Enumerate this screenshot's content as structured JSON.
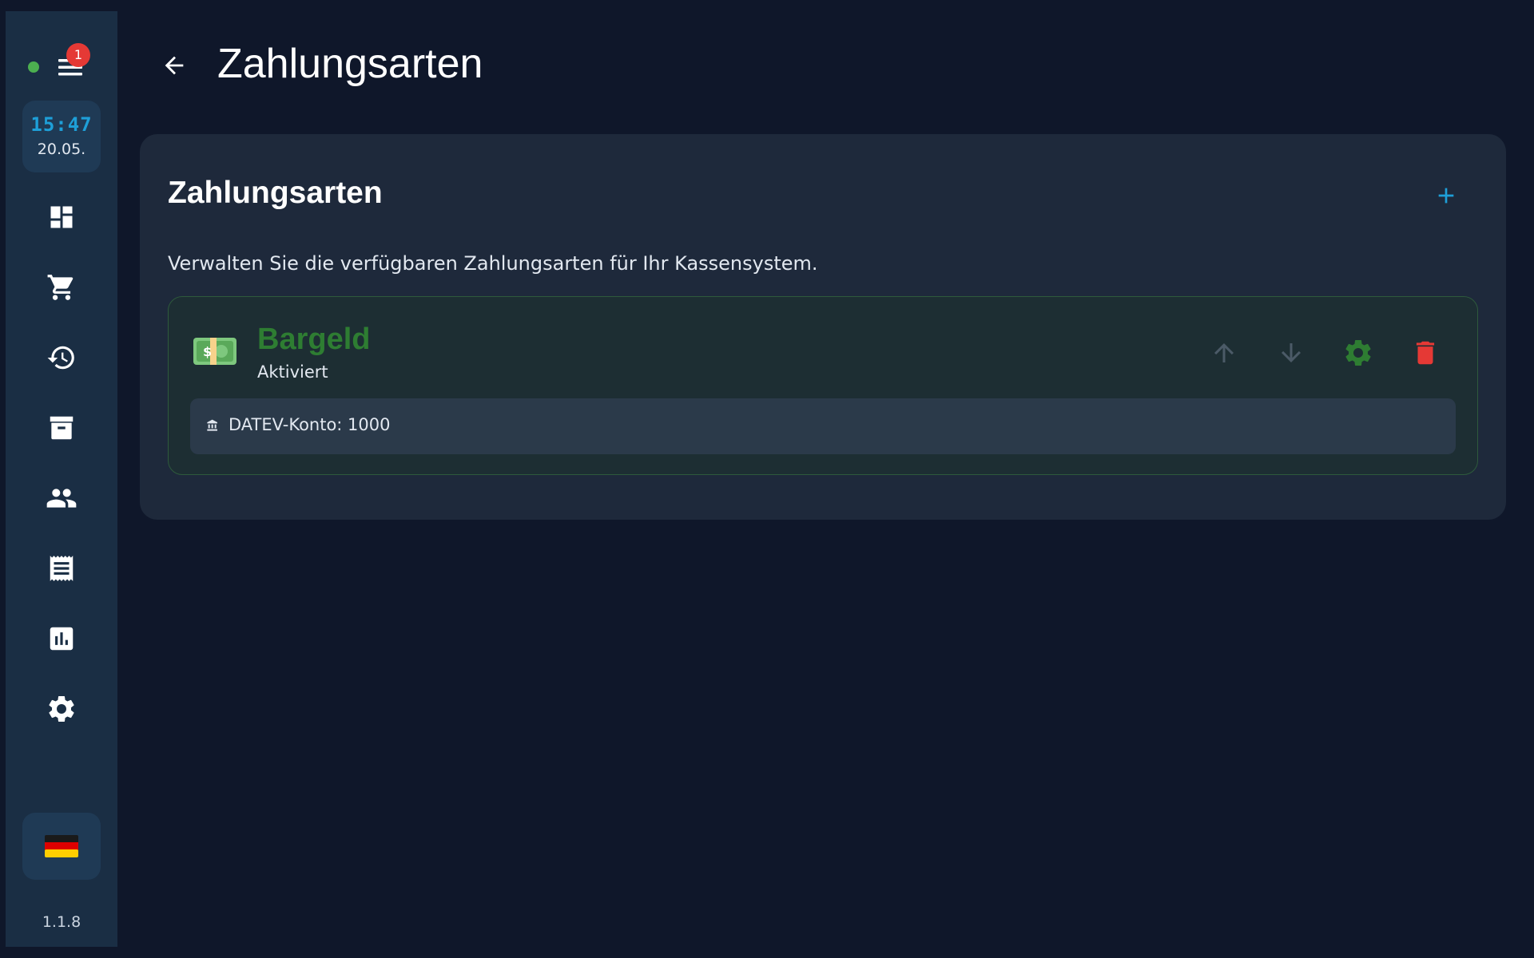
{
  "app": {
    "title": "Zahlungsarten"
  },
  "sidebar": {
    "status": "online",
    "notification_count": "1",
    "clock": {
      "time": "15:47",
      "date": "20.05."
    },
    "nav_items": [
      {
        "icon": "dashboard-icon"
      },
      {
        "icon": "cart-icon"
      },
      {
        "icon": "history-icon"
      },
      {
        "icon": "archive-icon"
      },
      {
        "icon": "users-icon"
      },
      {
        "icon": "receipt-icon"
      },
      {
        "icon": "chart-icon"
      },
      {
        "icon": "gear-icon"
      }
    ],
    "language_flag": "🇩🇪",
    "version": "1.1.8"
  },
  "header": {
    "title": "Zahlungsarten"
  },
  "card": {
    "title": "Zahlungsarten",
    "description": "Verwalten Sie die verfügbaren Zahlungsarten für Ihr Kassensystem.",
    "payment_methods": [
      {
        "name": "Bargeld",
        "status": "Aktiviert",
        "icon": "banknote-icon",
        "detail": "DATEV-Konto: 1000"
      }
    ]
  },
  "colors": {
    "background": "#0f172a",
    "sidebar": "#1a2e44",
    "card": "#1e293b",
    "accent": "#1e9fd8",
    "active_green": "#2e7d32",
    "danger": "#e53935"
  }
}
